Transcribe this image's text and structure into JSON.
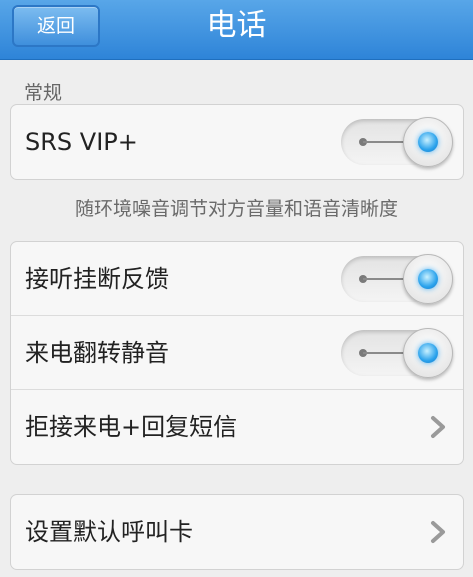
{
  "header": {
    "back_label": "返回",
    "title": "电话"
  },
  "sections": {
    "general_label": "常规"
  },
  "group1": {
    "srs_label": "SRS VIP+",
    "srs_on": true,
    "srs_description": "随环境噪音调节对方音量和语音清晰度"
  },
  "group2": {
    "answer_hangup_label": "接听挂断反馈",
    "answer_hangup_on": true,
    "flip_mute_label": "来电翻转静音",
    "flip_mute_on": true,
    "reject_sms_label": "拒接来电+回复短信"
  },
  "group3": {
    "default_card_label": "设置默认呼叫卡"
  },
  "colors": {
    "header": "#2e84d8",
    "toggle_led": "#2aa2ec"
  },
  "icons": {
    "toggle": "switch-on-icon",
    "chevron": "chevron-right-icon"
  }
}
